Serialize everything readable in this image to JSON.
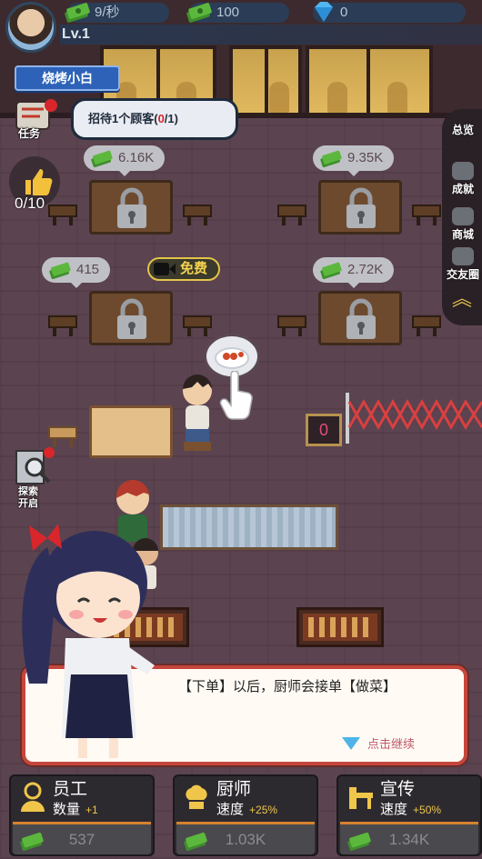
{
  "top_bar": {
    "income_rate": "9/秒",
    "cash": "100",
    "diamonds": "0",
    "level": "Lv.1"
  },
  "player_title": "烧烤小白",
  "task": {
    "label": "任务",
    "bubble_prefix": "招待1个顾客(",
    "bubble_progress": "0",
    "bubble_suffix": "/1)"
  },
  "likes": {
    "count": "0/10"
  },
  "right_menu": [
    {
      "label": "总览"
    },
    {
      "label": "成就"
    },
    {
      "label": "商城"
    },
    {
      "label": "交友圈"
    }
  ],
  "locked_tables": [
    {
      "price": "6.16K"
    },
    {
      "price": "9.35K"
    },
    {
      "price": "415"
    },
    {
      "price": "2.72K"
    }
  ],
  "free_button": {
    "label": "免费"
  },
  "queue_sign": {
    "value": "0"
  },
  "explore": {
    "label_line1": "探索",
    "label_line2": "开启"
  },
  "dialog": {
    "text": "【下单】以后，厨师会接单【做菜】",
    "continue": "点击继续"
  },
  "upgrades": [
    {
      "name": "员工",
      "stat": "数量",
      "increment": "+1",
      "cost": "537"
    },
    {
      "name": "厨师",
      "stat": "速度",
      "increment": "+25%",
      "cost": "1.03K"
    },
    {
      "name": "宣传",
      "stat": "速度",
      "increment": "+50%",
      "cost": "1.34K"
    }
  ],
  "colors": {
    "accent_gold": "#e2c44a",
    "dialog_border": "#c6463c",
    "upgrade_bar": "#d6822f",
    "badge_red": "#d9262a"
  }
}
